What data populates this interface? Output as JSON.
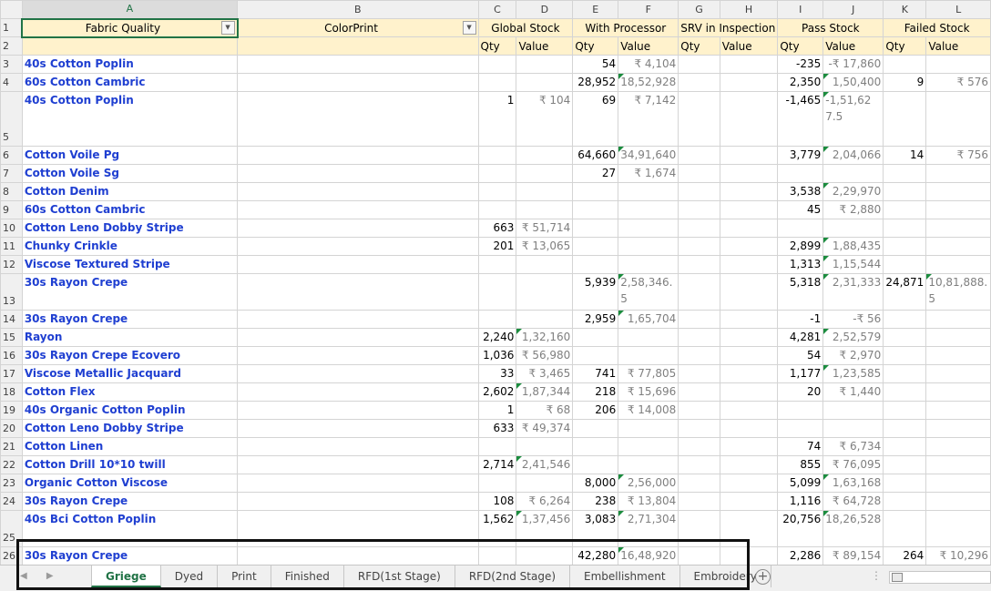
{
  "columns": [
    "A",
    "B",
    "C",
    "D",
    "E",
    "F",
    "G",
    "H",
    "I",
    "J",
    "K",
    "L"
  ],
  "header_row1": {
    "fabric_quality": "Fabric Quality",
    "color_print": "ColorPrint",
    "global_stock": "Global Stock",
    "with_processor": "With Processor",
    "srv_in_inspection": "SRV in Inspection",
    "pass_stock": "Pass Stock",
    "failed_stock": "Failed Stock"
  },
  "header_row2": {
    "qty": "Qty",
    "value": "Value"
  },
  "rows": [
    {
      "rn": "3",
      "a": "40s Cotton Poplin",
      "c": "",
      "d": "",
      "e": "54",
      "f": "₹ 4,104",
      "g": "",
      "h": "",
      "i": "-235",
      "j": "-₹ 17,860",
      "k": "",
      "l": ""
    },
    {
      "rn": "4",
      "a": "60s Cotton Cambric",
      "c": "",
      "d": "",
      "e": "28,952",
      "f": "18,52,928",
      "g": "",
      "h": "",
      "i": "2,350",
      "j": "1,50,400",
      "k": "9",
      "l": "₹ 576"
    },
    {
      "rn": "5",
      "a": "40s Cotton Poplin",
      "c": "1",
      "d": "₹ 104",
      "e": "69",
      "f": "₹ 7,142",
      "g": "",
      "h": "",
      "i": "-1,465",
      "j": "-1,51,627.5",
      "k": "",
      "l": ""
    },
    {
      "rn": "6",
      "a": "Cotton Voile Pg",
      "c": "",
      "d": "",
      "e": "64,660",
      "f": "34,91,640",
      "g": "",
      "h": "",
      "i": "3,779",
      "j": "2,04,066",
      "k": "14",
      "l": "₹ 756"
    },
    {
      "rn": "7",
      "a": "Cotton Voile Sg",
      "c": "",
      "d": "",
      "e": "27",
      "f": "₹ 1,674",
      "g": "",
      "h": "",
      "i": "",
      "j": "",
      "k": "",
      "l": ""
    },
    {
      "rn": "8",
      "a": "Cotton Denim",
      "c": "",
      "d": "",
      "e": "",
      "f": "",
      "g": "",
      "h": "",
      "i": "3,538",
      "j": "2,29,970",
      "k": "",
      "l": ""
    },
    {
      "rn": "9",
      "a": "60s Cotton Cambric",
      "c": "",
      "d": "",
      "e": "",
      "f": "",
      "g": "",
      "h": "",
      "i": "45",
      "j": "₹ 2,880",
      "k": "",
      "l": ""
    },
    {
      "rn": "10",
      "a": "Cotton Leno Dobby Stripe",
      "c": "663",
      "d": "₹ 51,714",
      "e": "",
      "f": "",
      "g": "",
      "h": "",
      "i": "",
      "j": "",
      "k": "",
      "l": ""
    },
    {
      "rn": "11",
      "a": "Chunky Crinkle",
      "c": "201",
      "d": "₹ 13,065",
      "e": "",
      "f": "",
      "g": "",
      "h": "",
      "i": "2,899",
      "j": "1,88,435",
      "k": "",
      "l": ""
    },
    {
      "rn": "12",
      "a": "Viscose Textured Stripe",
      "c": "",
      "d": "",
      "e": "",
      "f": "",
      "g": "",
      "h": "",
      "i": "1,313",
      "j": "1,15,544",
      "k": "",
      "l": ""
    },
    {
      "rn": "13",
      "a": "30s Rayon Crepe",
      "c": "",
      "d": "",
      "e": "5,939",
      "f": "2,58,346.5",
      "g": "",
      "h": "",
      "i": "5,318",
      "j": "2,31,333",
      "k": "24,871",
      "l": "10,81,888.5"
    },
    {
      "rn": "14",
      "a": "30s Rayon Crepe",
      "c": "",
      "d": "",
      "e": "2,959",
      "f": "1,65,704",
      "g": "",
      "h": "",
      "i": "-1",
      "j": "-₹ 56",
      "k": "",
      "l": ""
    },
    {
      "rn": "15",
      "a": "Rayon",
      "c": "2,240",
      "d": "1,32,160",
      "e": "",
      "f": "",
      "g": "",
      "h": "",
      "i": "4,281",
      "j": "2,52,579",
      "k": "",
      "l": ""
    },
    {
      "rn": "16",
      "a": "30s Rayon Crepe Ecovero",
      "c": "1,036",
      "d": "₹ 56,980",
      "e": "",
      "f": "",
      "g": "",
      "h": "",
      "i": "54",
      "j": "₹ 2,970",
      "k": "",
      "l": ""
    },
    {
      "rn": "17",
      "a": "Viscose Metallic Jacquard",
      "c": "33",
      "d": "₹ 3,465",
      "e": "741",
      "f": "₹ 77,805",
      "g": "",
      "h": "",
      "i": "1,177",
      "j": "1,23,585",
      "k": "",
      "l": ""
    },
    {
      "rn": "18",
      "a": "Cotton Flex",
      "c": "2,602",
      "d": "1,87,344",
      "e": "218",
      "f": "₹ 15,696",
      "g": "",
      "h": "",
      "i": "20",
      "j": "₹ 1,440",
      "k": "",
      "l": ""
    },
    {
      "rn": "19",
      "a": "40s Organic Cotton Poplin",
      "c": "1",
      "d": "₹ 68",
      "e": "206",
      "f": "₹ 14,008",
      "g": "",
      "h": "",
      "i": "",
      "j": "",
      "k": "",
      "l": ""
    },
    {
      "rn": "20",
      "a": "Cotton Leno Dobby Stripe",
      "c": "633",
      "d": "₹ 49,374",
      "e": "",
      "f": "",
      "g": "",
      "h": "",
      "i": "",
      "j": "",
      "k": "",
      "l": ""
    },
    {
      "rn": "21",
      "a": "Cotton Linen",
      "c": "",
      "d": "",
      "e": "",
      "f": "",
      "g": "",
      "h": "",
      "i": "74",
      "j": "₹ 6,734",
      "k": "",
      "l": ""
    },
    {
      "rn": "22",
      "a": "Cotton Drill 10*10 twill",
      "c": "2,714",
      "d": "2,41,546",
      "e": "",
      "f": "",
      "g": "",
      "h": "",
      "i": "855",
      "j": "₹ 76,095",
      "k": "",
      "l": ""
    },
    {
      "rn": "23",
      "a": "Organic Cotton Viscose",
      "c": "",
      "d": "",
      "e": "8,000",
      "f": "2,56,000",
      "g": "",
      "h": "",
      "i": "5,099",
      "j": "1,63,168",
      "k": "",
      "l": ""
    },
    {
      "rn": "24",
      "a": "30s Rayon Crepe",
      "c": "108",
      "d": "₹ 6,264",
      "e": "238",
      "f": "₹ 13,804",
      "g": "",
      "h": "",
      "i": "1,116",
      "j": "₹ 64,728",
      "k": "",
      "l": ""
    },
    {
      "rn": "25",
      "a": "40s Bci Cotton Poplin",
      "c": "1,562",
      "d": "1,37,456",
      "e": "3,083",
      "f": "2,71,304",
      "g": "",
      "h": "",
      "i": "20,756",
      "j": "18,26,528",
      "k": "",
      "l": ""
    },
    {
      "rn": "26",
      "a": "30s Rayon Crepe",
      "c": "",
      "d": "",
      "e": "42,280",
      "f": "16,48,920",
      "g": "",
      "h": "",
      "i": "2,286",
      "j": "₹ 89,154",
      "k": "264",
      "l": "₹ 10,296"
    }
  ],
  "sheet_tabs": [
    "Griege",
    "Dyed",
    "Print",
    "Finished",
    "RFD(1st Stage)",
    "RFD(2nd Stage)",
    "Embellishment",
    "Embroidery"
  ],
  "active_tab": "Griege",
  "icons": {
    "nav_prev": "◀",
    "nav_next": "▶",
    "add_sheet": "+",
    "more": "⋮",
    "filter": "▼"
  },
  "colors": {
    "fabric_text": "#1f3fd1",
    "header_fill": "#fff2cc",
    "excel_green": "#217346"
  }
}
